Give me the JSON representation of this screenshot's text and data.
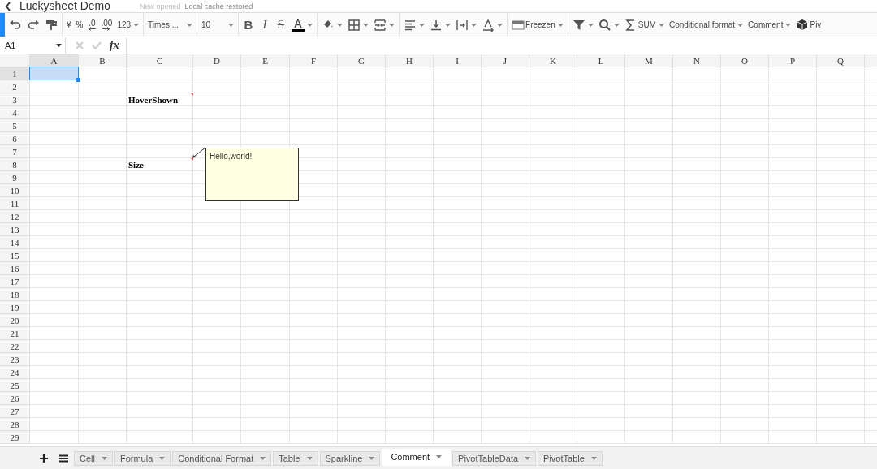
{
  "header": {
    "title": "Luckysheet Demo",
    "status_messages": [
      {
        "text": "New opened",
        "kind": "faint"
      },
      {
        "text": "Local cache restored",
        "kind": "normal"
      }
    ]
  },
  "toolbar": {
    "groups": [
      {
        "items": [
          {
            "kind": "icon",
            "dropdown": false
          },
          {
            "kind": "icon",
            "dropdown": false
          },
          {
            "kind": "icon",
            "dropdown": false
          }
        ]
      },
      {
        "items": [
          {
            "kind": "text",
            "label": "¥",
            "dropdown": false
          },
          {
            "kind": "text",
            "label": "%",
            "dropdown": false
          },
          {
            "kind": "decimal",
            "label": ".0",
            "dropdown": false
          },
          {
            "kind": "decimal",
            "label": ".00",
            "dropdown": false
          },
          {
            "kind": "text",
            "label": "123",
            "dropdown": true
          }
        ]
      },
      {
        "items": [
          {
            "kind": "select",
            "label": "Times ...",
            "dropdown": true
          }
        ]
      },
      {
        "items": [
          {
            "kind": "select",
            "label": "10",
            "dropdown": true
          }
        ]
      },
      {
        "items": [
          {
            "kind": "bold",
            "label": "B",
            "dropdown": false
          },
          {
            "kind": "italic",
            "label": "I",
            "dropdown": false
          },
          {
            "kind": "strike",
            "label": "S",
            "dropdown": false
          },
          {
            "kind": "color",
            "label": "A",
            "color": "#000000",
            "dropdown": true
          }
        ]
      },
      {
        "items": [
          {
            "kind": "icon",
            "dropdown": true
          },
          {
            "kind": "icon",
            "dropdown": true
          },
          {
            "kind": "icon",
            "dropdown": true
          }
        ]
      },
      {
        "items": [
          {
            "kind": "icon",
            "dropdown": true
          },
          {
            "kind": "icon",
            "dropdown": true
          },
          {
            "kind": "icon",
            "dropdown": true
          },
          {
            "kind": "icon",
            "dropdown": true
          }
        ]
      },
      {
        "items": [
          {
            "kind": "icon_text",
            "label": "Freezen",
            "dropdown": true
          }
        ]
      },
      {
        "items": [
          {
            "kind": "icon",
            "dropdown": true
          },
          {
            "kind": "icon",
            "dropdown": true
          },
          {
            "kind": "icon_text",
            "label": "SUM",
            "dropdown": true
          },
          {
            "kind": "text",
            "label": "Conditional format",
            "dropdown": true
          },
          {
            "kind": "text",
            "label": "Comment",
            "dropdown": true
          },
          {
            "kind": "icon_text",
            "label": "Piv",
            "dropdown": false
          }
        ]
      }
    ]
  },
  "formula_bar": {
    "cell_name": "A1",
    "function_label": "fx"
  },
  "grid": {
    "columns": [
      "A",
      "B",
      "C",
      "D",
      "E",
      "F",
      "G",
      "H",
      "I",
      "J",
      "K",
      "L",
      "M",
      "N",
      "O",
      "P",
      "Q"
    ],
    "rows": [
      {
        "label": "1",
        "cells": [
          {
            "kind": "text",
            "selected": true,
            "comment_marker": false
          }
        ]
      },
      {
        "label": "2"
      },
      {
        "label": "3",
        "cells": [
          {
            "kind": "empty"
          },
          {
            "kind": "empty"
          },
          {
            "kind": "text",
            "text": "HoverShown",
            "comment_marker": true,
            "selected": false
          }
        ]
      },
      {
        "label": "4"
      },
      {
        "label": "5"
      },
      {
        "label": "6"
      },
      {
        "label": "7"
      },
      {
        "label": "8",
        "cells": [
          {
            "kind": "empty"
          },
          {
            "kind": "empty"
          },
          {
            "kind": "text",
            "text": "Size",
            "comment_marker": true,
            "selected": false,
            "comment": {
              "text": "Hello,world!"
            }
          }
        ]
      },
      {
        "label": "9"
      },
      {
        "label": "10"
      },
      {
        "label": "11"
      },
      {
        "label": "12"
      },
      {
        "label": "13"
      },
      {
        "label": "14"
      },
      {
        "label": "15"
      },
      {
        "label": "16"
      },
      {
        "label": "17"
      },
      {
        "label": "18"
      },
      {
        "label": "19"
      },
      {
        "label": "20"
      },
      {
        "label": "21"
      },
      {
        "label": "22"
      },
      {
        "label": "23"
      },
      {
        "label": "24"
      },
      {
        "label": "25"
      },
      {
        "label": "26"
      },
      {
        "label": "27"
      },
      {
        "label": "28"
      },
      {
        "label": "29"
      }
    ]
  },
  "sheet_tabs": [
    {
      "label": "Cell",
      "selected": false
    },
    {
      "label": "Formula",
      "selected": false
    },
    {
      "label": "Conditional Format",
      "selected": false
    },
    {
      "label": "Table",
      "selected": false
    },
    {
      "label": "Sparkline",
      "selected": false
    },
    {
      "label": "Comment",
      "selected": true
    },
    {
      "label": "PivotTableData",
      "selected": false
    },
    {
      "label": "PivotTable",
      "selected": false
    }
  ]
}
